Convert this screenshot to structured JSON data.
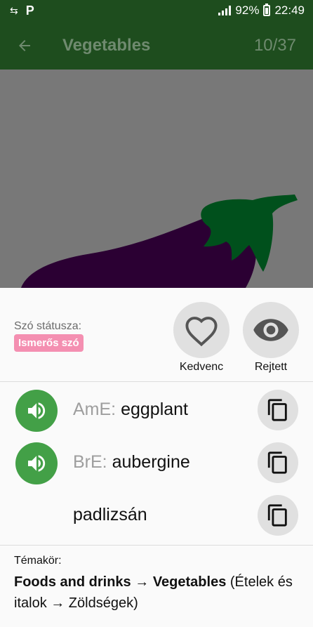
{
  "status_bar": {
    "battery_percent": "92%",
    "time": "22:49"
  },
  "app_bar": {
    "title": "Vegetables",
    "counter": "10/37"
  },
  "word_status": {
    "label": "Szó státusza:",
    "badge": "Ismerős szó",
    "badge_color": "#f48fb1"
  },
  "actions": {
    "favorite_label": "Kedvenc",
    "hidden_label": "Rejtett"
  },
  "translations": [
    {
      "prefix": "AmE:",
      "word": "eggplant"
    },
    {
      "prefix": "BrE:",
      "word": "aubergine"
    },
    {
      "prefix": "",
      "word": "padlizsán"
    }
  ],
  "topic": {
    "label": "Témakör:",
    "category": "Foods and drinks",
    "arrow": "→",
    "subcategory": "Vegetables",
    "translation": "(Ételek és italok → Zöldségek)"
  },
  "colors": {
    "app_bar": "#1e4d1e",
    "speaker_button": "#43a047",
    "eggplant_body": "#2b0033",
    "eggplant_cap": "#00501c"
  }
}
